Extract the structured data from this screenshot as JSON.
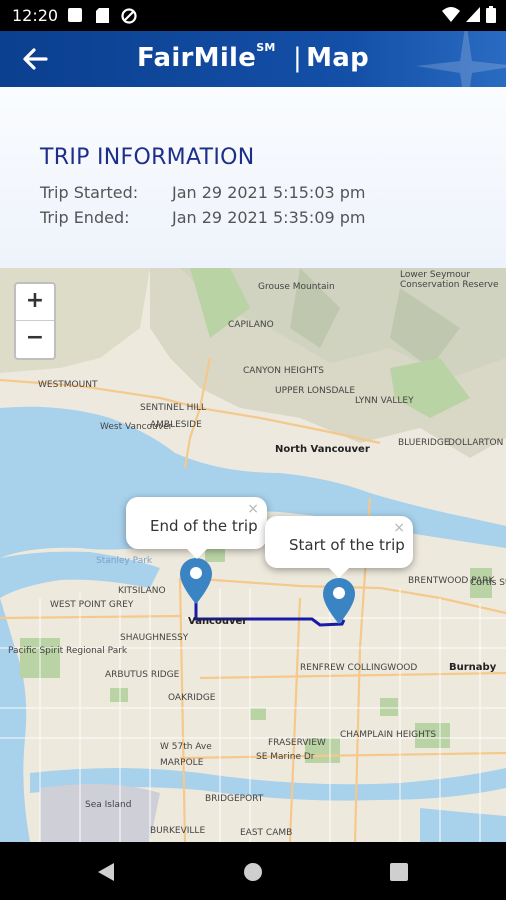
{
  "status_bar": {
    "time": "12:20"
  },
  "app_bar": {
    "brand": "FairMile",
    "brand_mark": "SM",
    "separator": "|",
    "section": "Map"
  },
  "trip_info": {
    "heading": "TRIP INFORMATION",
    "started_label": "Trip Started:",
    "started_value": "Jan 29 2021 5:15:03 pm",
    "ended_label": "Trip Ended:",
    "ended_value": "Jan 29 2021 5:35:09 pm"
  },
  "map": {
    "zoom_in": "+",
    "zoom_out": "−",
    "end_popup": {
      "text": "End of the trip",
      "close": "×"
    },
    "start_popup": {
      "text": "Start of the trip",
      "close": "×"
    },
    "route_color": "#1a1aa8",
    "marker_color": "#3b84c4",
    "labels": {
      "west_vancouver": "West Vancouver",
      "north_vancouver": "North Vancouver",
      "vancouver": "Vancouver",
      "burnaby": "Burnaby",
      "sea_island": "Sea Island",
      "kitsilano": "KITSILANO",
      "west_point_grey": "WEST POINT GREY",
      "pacific_spirit": "Pacific Spirit Regional Park",
      "shaughnessy": "SHAUGHNESSY",
      "arbutus_ridge": "ARBUTUS RIDGE",
      "oakridge": "OAKRIDGE",
      "marpole": "MARPOLE",
      "renfrew": "RENFREW COLLINGWOOD",
      "brentwood": "BRENTWOOD PARK",
      "capilano": "CAPILANO",
      "lynn_valley": "LYNN VALLEY",
      "upper_lonsdale": "UPPER LONSDALE",
      "canyon_heights": "CANYON HEIGHTS",
      "blueridge": "BLUERIDGE",
      "grouse": "Grouse Mountain",
      "ambleside": "AMBLESIDE",
      "sentinel": "SENTINEL HILL",
      "westmount": "WESTMOUNT",
      "dollarton": "DOLLARTON",
      "champlain": "CHAMPLAIN HEIGHTS",
      "fraserview": "FRASERVIEW",
      "bridgeport": "BRIDGEPORT",
      "burkeville": "BURKEVILLE",
      "se_marine": "SE Marine Dr",
      "east_camb": "EAST CAMB",
      "lower_seymour": "Lower Seymour Conservation Reserve",
      "stanley": "Stanley Park",
      "n57th": "W 57th Ave",
      "curtis": "Curtis St"
    }
  }
}
